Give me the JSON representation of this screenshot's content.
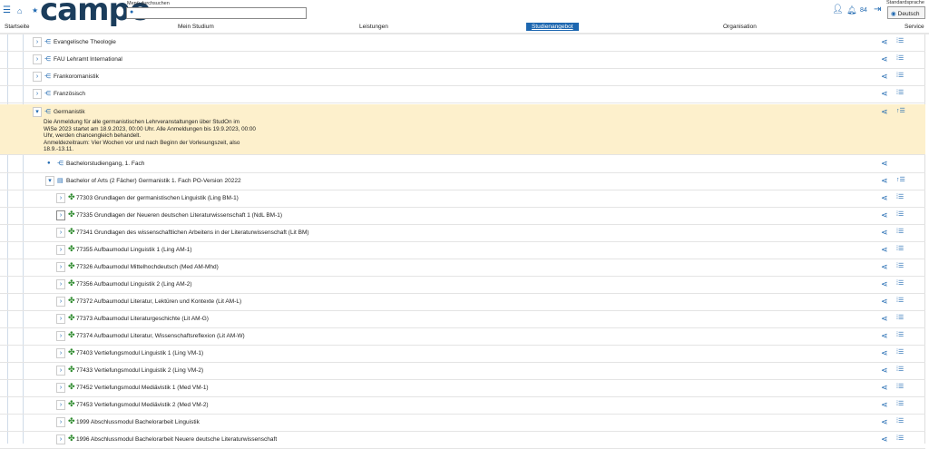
{
  "header": {
    "logo": "campo",
    "search_label": "Menü durchsuchen",
    "search_value": "",
    "counter": "84",
    "lang_label": "Standardsprache",
    "lang_value": "Deutsch"
  },
  "nav": [
    "Startseite",
    "Mein Studium",
    "Leistungen",
    "Studienangebot",
    "Organisation",
    "Service"
  ],
  "rows_top": [
    "Evangelische Theologie",
    "FAU Lehramt International",
    "Frankoromanistik",
    "Französisch"
  ],
  "germanistik": {
    "title": "Germanistik",
    "note": [
      "Die Anmeldung für alle germanistischen Lehrveranstaltungen über StudOn im",
      "WiSe 2023 startet am 18.9.2023, 00:00 Uhr. Alle Anmeldungen bis 19.9.2023, 00:00",
      "Uhr, werden chancengleich behandelt.",
      "Anmeldezeitraum: Vier Wochen vor und nach Beginn der Vorlesungszeit, also",
      "18.9.-13.11."
    ]
  },
  "bachelor_studiengang": "Bachelorstudiengang, 1. Fach",
  "program": "Bachelor of Arts (2 Fächer) Germanistik 1. Fach PO-Version 20222",
  "modules": [
    "77303 Grundlagen der germanistischen Linguistik (Ling BM-1)",
    "77335 Grundlagen der Neueren deutschen Literaturwissenschaft 1 (NdL BM-1)",
    "77341 Grundlagen des wissenschaftlichen Arbeitens in der Literaturwissenschaft (Lit BM)",
    "77355 Aufbaumodul Linguistik 1 (Ling AM-1)",
    "77326 Aufbaumodul Mittelhochdeutsch (Med AM-Mhd)",
    "77356 Aufbaumodul Linguistik 2 (Ling AM-2)",
    "77372 Aufbaumodul Literatur, Lektüren und Kontexte (Lit AM-L)",
    "77373 Aufbaumodul Literaturgeschichte (Lit AM-G)",
    "77374 Aufbaumodul Literatur, Wissenschaftsreflexion (Lit AM-W)",
    "77403 Vertiefungsmodul Linguistik 1 (Ling VM-1)",
    "77433 Vertiefungsmodul Linguistik 2 (Ling VM-2)",
    "77452 Vertiefungsmodul Mediävistik 1 (Med VM-1)",
    "77453 Vertiefungsmodul Mediävistik 2 (Med VM-2)",
    "1999 Abschlussmodul Bachelorarbeit Linguistik",
    "1996 Abschlussmodul Bachelorarbeit Neuere deutsche Literaturwissenschaft"
  ],
  "colors": {
    "accent": "#1d67b0",
    "highlight": "#fdf0cc",
    "module_icon": "#2e8b2e"
  }
}
